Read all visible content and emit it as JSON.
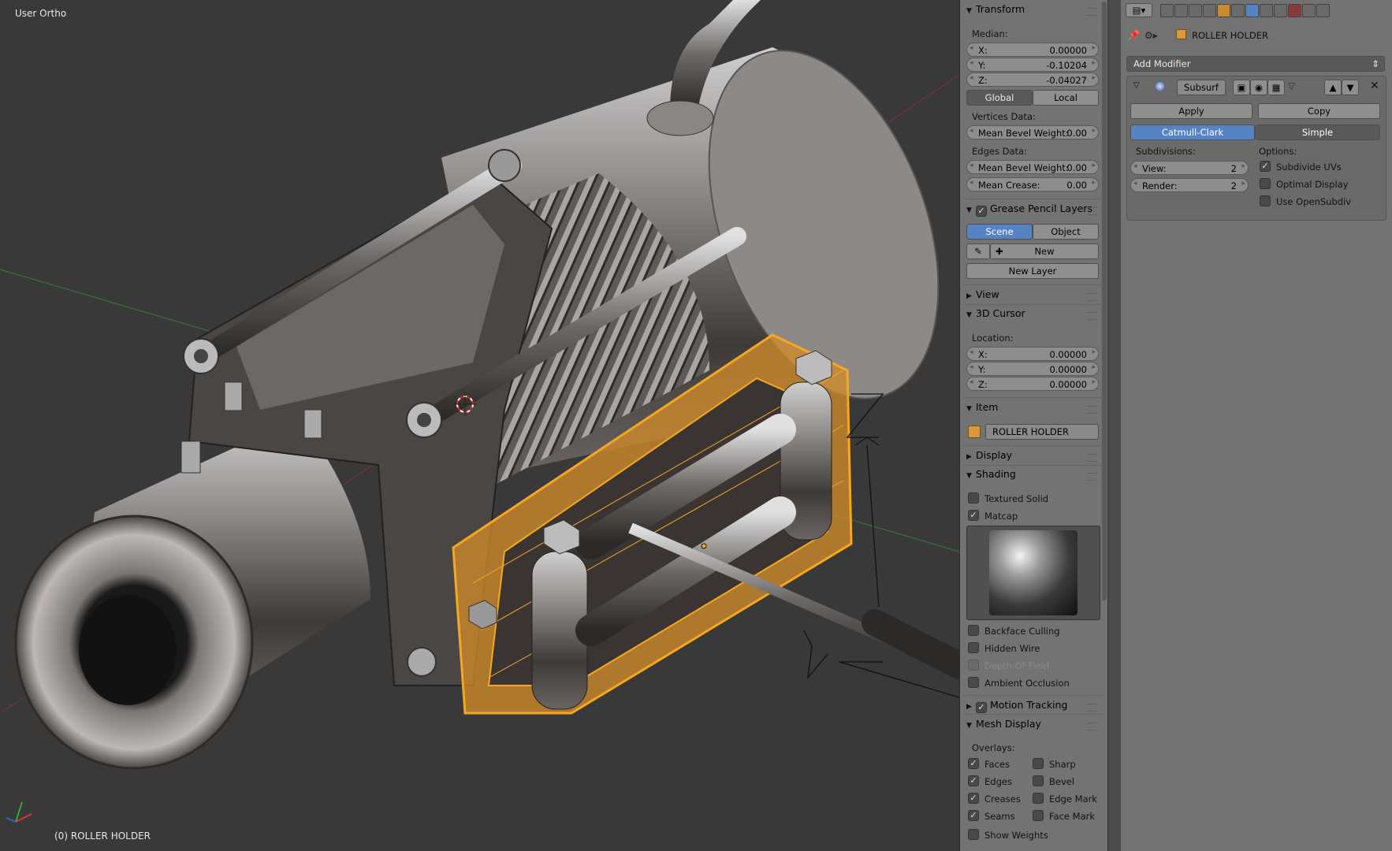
{
  "viewport": {
    "view_label": "User Ortho",
    "object_label": "(0) ROLLER HOLDER"
  },
  "transform": {
    "title": "Transform",
    "median_label": "Median:",
    "x_name": "X:",
    "x_value": "0.00000",
    "y_name": "Y:",
    "y_value": "-0.10204",
    "z_name": "Z:",
    "z_value": "-0.04027",
    "global_label": "Global",
    "local_label": "Local",
    "vertices_label": "Vertices Data:",
    "mean_bevel_v_name": "Mean Bevel Weight:",
    "mean_bevel_v_value": "0.00",
    "edges_label": "Edges Data:",
    "mean_bevel_e_name": "Mean Bevel Weight:",
    "mean_bevel_e_value": "0.00",
    "mean_crease_name": "Mean Crease:",
    "mean_crease_value": "0.00"
  },
  "grease_pencil": {
    "title": "Grease Pencil Layers",
    "scene_label": "Scene",
    "object_label": "Object",
    "new_label": "New",
    "new_layer_label": "New Layer"
  },
  "view_section": {
    "title": "View"
  },
  "cursor": {
    "title": "3D Cursor",
    "location_label": "Location:",
    "x_name": "X:",
    "x_value": "0.00000",
    "y_name": "Y:",
    "y_value": "0.00000",
    "z_name": "Z:",
    "z_value": "0.00000"
  },
  "item": {
    "title": "Item",
    "name_value": "ROLLER HOLDER"
  },
  "display": {
    "title": "Display"
  },
  "shading": {
    "title": "Shading",
    "textured_solid": "Textured Solid",
    "matcap": "Matcap",
    "backface_culling": "Backface Culling",
    "hidden_wire": "Hidden Wire",
    "depth_of_field": "Depth Of Field",
    "ambient_occlusion": "Ambient Occlusion"
  },
  "motion_tracking": {
    "title": "Motion Tracking"
  },
  "mesh_display": {
    "title": "Mesh Display",
    "overlays_label": "Overlays:",
    "faces": "Faces",
    "sharp": "Sharp",
    "edges": "Edges",
    "bevel": "Bevel",
    "creases": "Creases",
    "edge_mark": "Edge Mark",
    "seams": "Seams",
    "face_mark": "Face Mark",
    "show_weights": "Show Weights"
  },
  "properties": {
    "object_name": "ROLLER HOLDER",
    "add_modifier": "Add Modifier",
    "modifier_name": "Subsurf",
    "apply_label": "Apply",
    "copy_label": "Copy",
    "catmull_label": "Catmull-Clark",
    "simple_label": "Simple",
    "subdivisions_label": "Subdivisions:",
    "options_label": "Options:",
    "view_name": "View:",
    "view_value": "2",
    "render_name": "Render:",
    "render_value": "2",
    "subdivide_uvs": "Subdivide UVs",
    "optimal_display": "Optimal Display",
    "use_opensubdiv": "Use OpenSubdiv"
  },
  "colors": {
    "selection": "#f5a623",
    "accent_blue": "#5683c3",
    "panel_bg": "#737373"
  }
}
